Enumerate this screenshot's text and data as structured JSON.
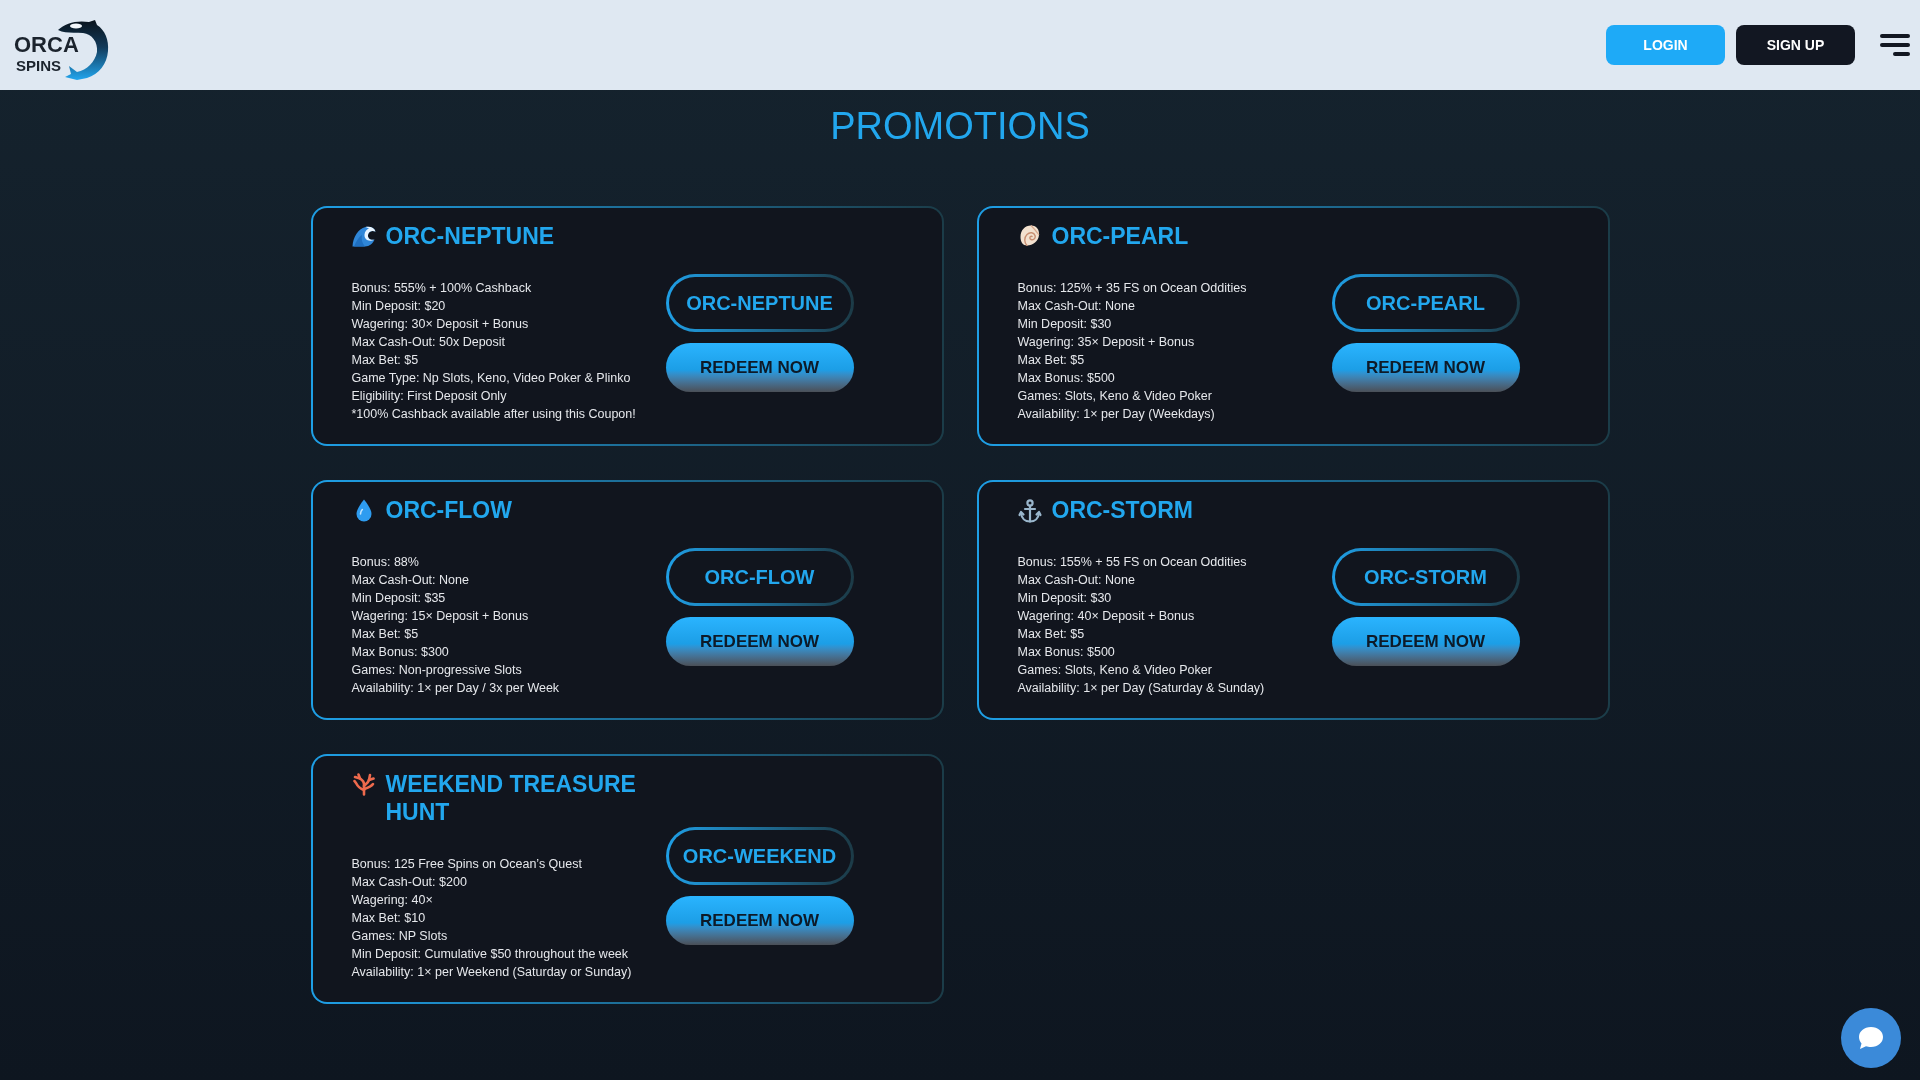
{
  "header": {
    "logo": {
      "title": "ORCA",
      "subtitle": "SPINS"
    },
    "buttons": [
      {
        "label": "LOGIN",
        "kind": "primary"
      },
      {
        "label": "SIGN UP",
        "kind": "dark"
      }
    ]
  },
  "page_title": "PROMOTIONS",
  "promotions": [
    {
      "title": "ORC-NEPTUNE",
      "details": [
        "Bonus: 555% + 100% Cashback",
        "Min Deposit: $20",
        "Wagering: 30× Deposit + Bonus",
        "Max Cash-Out: 50x Deposit",
        "Max Bet: $5",
        "Game Type: Np Slots, Keno, Video Poker & Plinko",
        "Eligibility: First Deposit Only",
        "*100% Cashback available after using this Coupon!"
      ],
      "coupon_code": "ORC-NEPTUNE",
      "action": "REDEEM NOW"
    },
    {
      "title": "ORC-PEARL",
      "details": [
        "Bonus: 125% + 35 FS on Ocean Oddities",
        "Max Cash-Out: None",
        "Min Deposit: $30",
        "Wagering: 35× Deposit + Bonus",
        "Max Bet: $5",
        "Max Bonus: $500",
        "Games: Slots, Keno & Video Poker",
        "Availability: 1× per Day (Weekdays)"
      ],
      "coupon_code": "ORC-PEARL",
      "action": "REDEEM NOW"
    },
    {
      "title": "ORC-FLOW",
      "details": [
        "Bonus: 88%",
        "Max Cash-Out: None",
        "Min Deposit: $35",
        "Wagering: 15× Deposit + Bonus",
        "Max Bet: $5",
        "Max Bonus: $300",
        "Games: Non-progressive Slots",
        "Availability: 1× per Day / 3x per Week"
      ],
      "coupon_code": "ORC-FLOW",
      "action": "REDEEM NOW"
    },
    {
      "title": "ORC-STORM",
      "details": [
        "Bonus: 155% + 55 FS on Ocean Oddities",
        "Max Cash-Out: None",
        "Min Deposit: $30",
        "Wagering: 40× Deposit + Bonus",
        "Max Bet: $5",
        "Max Bonus: $500",
        "Games: Slots, Keno & Video Poker",
        "Availability: 1× per Day (Saturday & Sunday)"
      ],
      "coupon_code": "ORC-STORM",
      "action": "REDEEM NOW"
    },
    {
      "title": "WEEKEND TREASURE HUNT",
      "details": [
        "Bonus: 125 Free Spins on Ocean’s Quest",
        "Max Cash-Out: $200",
        "Wagering: 40×",
        "Max Bet: $10",
        "Games: NP Slots",
        "Min Deposit: Cumulative $50 throughout the week",
        "Availability: 1× per Weekend (Saturday or Sunday)"
      ],
      "coupon_code": "ORC-WEEKEND",
      "action": "REDEEM NOW"
    }
  ]
}
